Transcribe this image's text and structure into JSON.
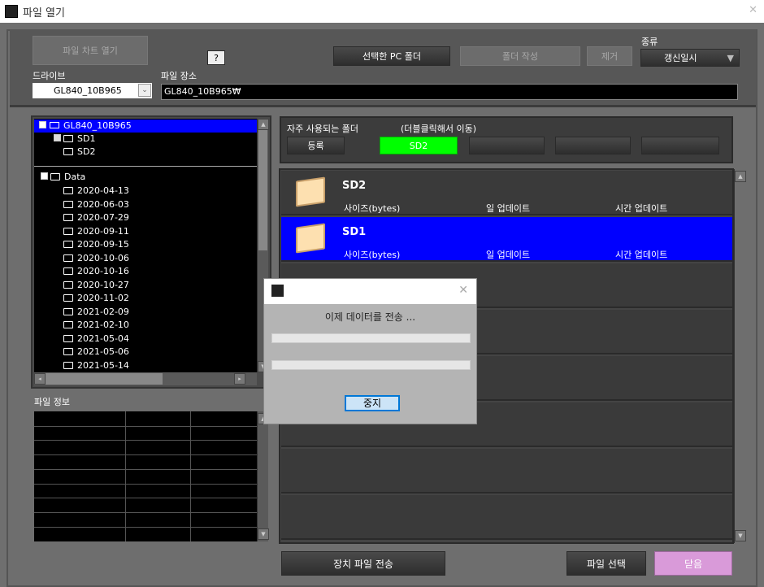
{
  "window": {
    "title": "파일 열기",
    "close": "✕"
  },
  "toolbar": {
    "open_chart": "파일 차트 열기",
    "help": "?",
    "selected_pc_folder": "선택한 PC 폴더",
    "create_folder": "폴더 작성",
    "remove": "제거",
    "sort_label": "종류",
    "sort_value": "갱신일시"
  },
  "drive": {
    "label": "드라이브",
    "value": "GL840_10B965"
  },
  "location": {
    "label": "파일 장소",
    "value": "GL840_10B965₩"
  },
  "tree": {
    "root": "GL840_10B965",
    "children": [
      "SD1",
      "SD2"
    ],
    "data_root": "Data",
    "dates": [
      "2020-04-13",
      "2020-06-03",
      "2020-07-29",
      "2020-09-11",
      "2020-09-15",
      "2020-10-06",
      "2020-10-16",
      "2020-10-27",
      "2020-11-02",
      "2021-02-09",
      "2021-02-10",
      "2021-05-04",
      "2021-05-06",
      "2021-05-14"
    ]
  },
  "file_info": {
    "label": "파일 정보"
  },
  "favorites": {
    "label": "자주 사용되는 폴더",
    "hint": "(더블클릭해서 이동)",
    "register": "등록",
    "slots": [
      "SD2",
      "",
      "",
      ""
    ],
    "active_color": "#00ff00"
  },
  "files": [
    {
      "name": "SD2",
      "size": "사이즈(bytes)",
      "date": "일 업데이트",
      "time": "시간 업데이트",
      "selected": false
    },
    {
      "name": "SD1",
      "size": "사이즈(bytes)",
      "date": "일 업데이트",
      "time": "시간 업데이트",
      "selected": true
    }
  ],
  "bottom": {
    "transfer": "장치 파일 전송",
    "select": "파일 선택",
    "close": "닫음"
  },
  "dialog": {
    "message": "이제 데이터를 전송 ...",
    "progress1": 0,
    "progress2": 0,
    "stop": "중지",
    "close": "✕"
  }
}
